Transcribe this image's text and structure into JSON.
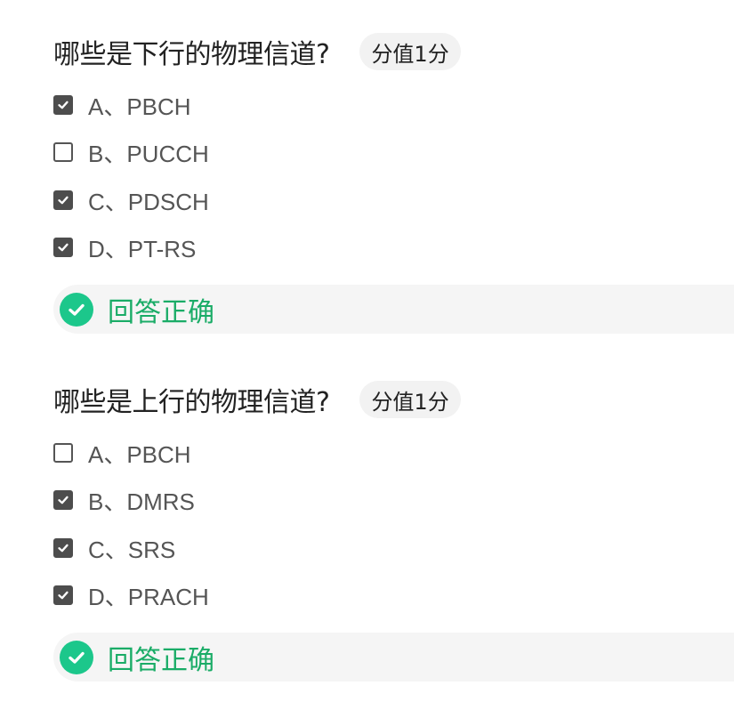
{
  "questions": [
    {
      "title": "哪些是下行的物理信道?",
      "score": "分值1分",
      "options": [
        {
          "label": "A、PBCH",
          "checked": true
        },
        {
          "label": "B、PUCCH",
          "checked": false
        },
        {
          "label": "C、PDSCH",
          "checked": true
        },
        {
          "label": "D、PT-RS",
          "checked": true
        }
      ],
      "result": {
        "text": "回答正确",
        "status": "correct",
        "icon": "check-circle-icon"
      }
    },
    {
      "title": "哪些是上行的物理信道?",
      "score": "分值1分",
      "options": [
        {
          "label": "A、PBCH",
          "checked": false
        },
        {
          "label": "B、DMRS",
          "checked": true
        },
        {
          "label": "C、SRS",
          "checked": true
        },
        {
          "label": "D、PRACH",
          "checked": true
        }
      ],
      "result": {
        "text": "回答正确",
        "status": "correct",
        "icon": "check-circle-icon"
      }
    }
  ],
  "colors": {
    "correct_text": "#1aac67",
    "correct_icon_bg": "#1cc78b",
    "checkbox_checked": "#4d4d4d",
    "badge_bg": "#f2f2f2",
    "result_bg": "#f5f5f5"
  }
}
